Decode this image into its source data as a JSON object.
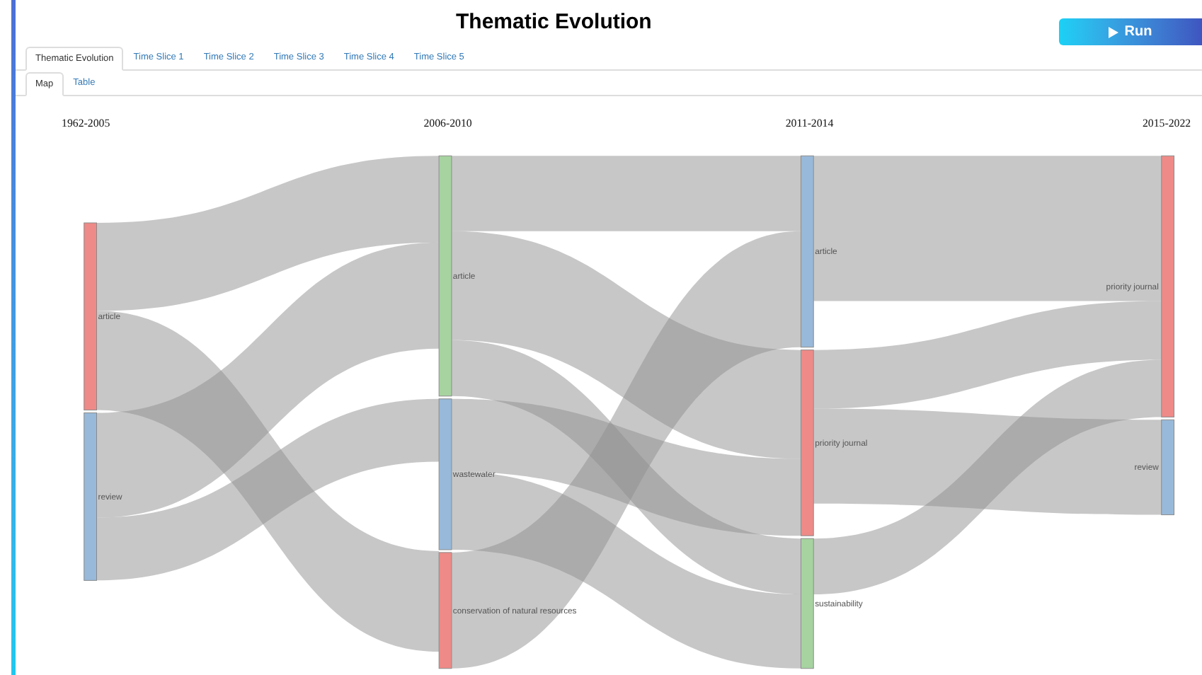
{
  "title": "Thematic Evolution",
  "run_button": {
    "label": "Run"
  },
  "tabs": [
    {
      "label": "Thematic Evolution",
      "selected": true
    },
    {
      "label": "Time Slice 1",
      "selected": false
    },
    {
      "label": "Time Slice 2",
      "selected": false
    },
    {
      "label": "Time Slice 3",
      "selected": false
    },
    {
      "label": "Time Slice 4",
      "selected": false
    },
    {
      "label": "Time Slice 5",
      "selected": false
    }
  ],
  "subtabs": [
    {
      "label": "Map",
      "selected": true
    },
    {
      "label": "Table",
      "selected": false
    }
  ],
  "columns": [
    {
      "label": "1962-2005",
      "nodes": [
        {
          "label": "article",
          "color": "#ee8a87"
        },
        {
          "label": "review",
          "color": "#98b9d9"
        }
      ]
    },
    {
      "label": "2006-2010",
      "nodes": [
        {
          "label": "article",
          "color": "#a6d3a0"
        },
        {
          "label": "wastewater",
          "color": "#98b9d9"
        },
        {
          "label": "conservation of natural resources",
          "color": "#ee8a87"
        }
      ]
    },
    {
      "label": "2011-2014",
      "nodes": [
        {
          "label": "article",
          "color": "#98b9d9"
        },
        {
          "label": "priority journal",
          "color": "#ee8a87"
        },
        {
          "label": "sustainability",
          "color": "#a6d3a0"
        }
      ]
    },
    {
      "label": "2015-2022",
      "nodes": [
        {
          "label": "priority journal",
          "color": "#ee8a87"
        },
        {
          "label": "review",
          "color": "#98b9d9"
        }
      ]
    }
  ]
}
